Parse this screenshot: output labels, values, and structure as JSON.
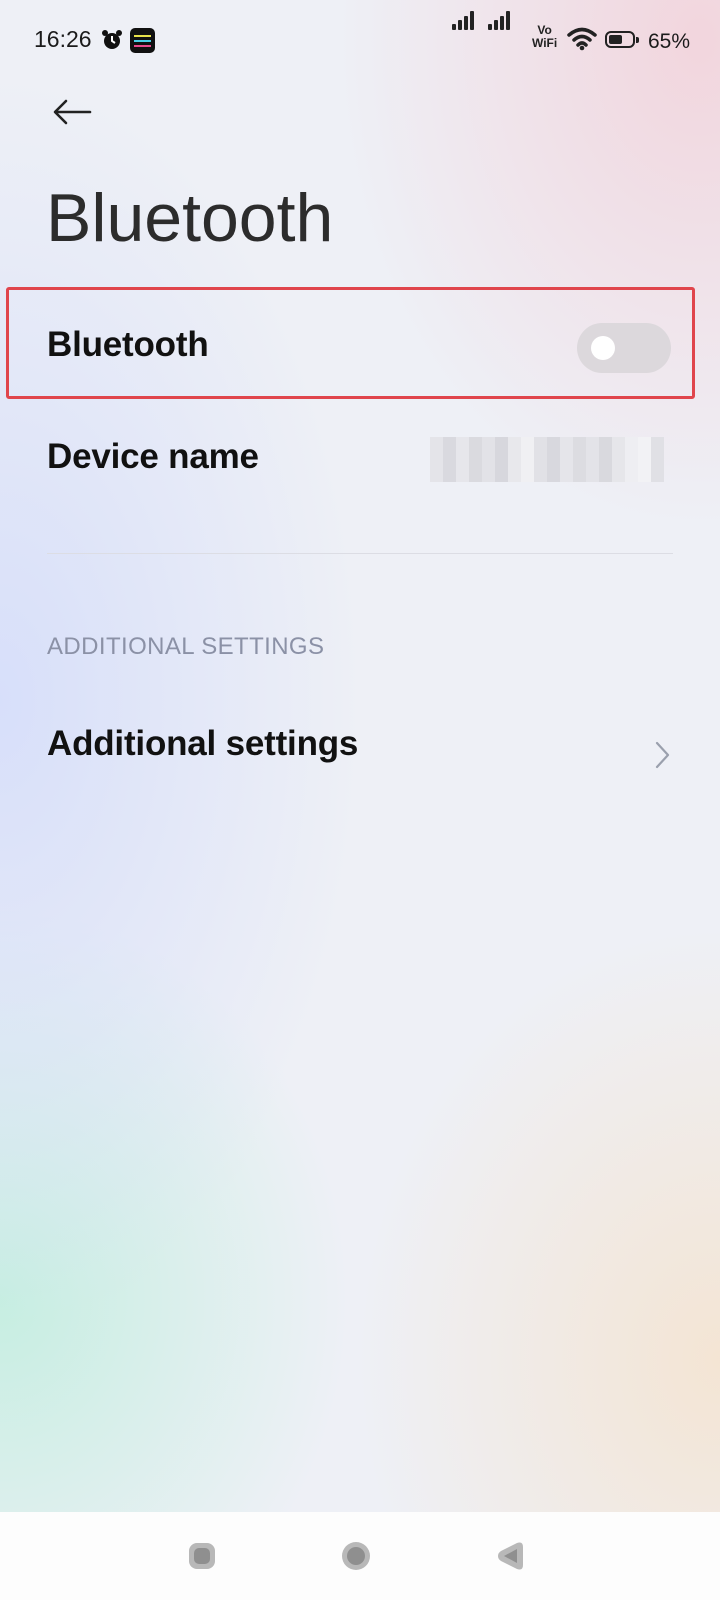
{
  "status_bar": {
    "time": "16:26",
    "vowifi_line1": "Vo",
    "vowifi_line2": "WiFi",
    "battery_percent": "65%",
    "battery_level": 0.65,
    "icons": [
      "alarm-icon",
      "app-notification-icon",
      "signal-icon",
      "signal-icon",
      "vowifi-icon",
      "wifi-icon",
      "battery-icon"
    ]
  },
  "header": {
    "back_icon": "arrow-left-icon",
    "title": "Bluetooth"
  },
  "settings": {
    "bluetooth": {
      "label": "Bluetooth",
      "enabled": false
    },
    "device_name": {
      "label": "Device name"
    },
    "section_header": "ADDITIONAL SETTINGS",
    "additional": {
      "label": "Additional settings",
      "icon": "chevron-right-icon"
    }
  },
  "nav_bar": {
    "buttons": [
      "recents-icon",
      "home-icon",
      "back-icon"
    ]
  },
  "colors": {
    "highlight": "#e0454c",
    "toggle_off": "#dcd8dc",
    "section_header": "#8b91a6"
  }
}
